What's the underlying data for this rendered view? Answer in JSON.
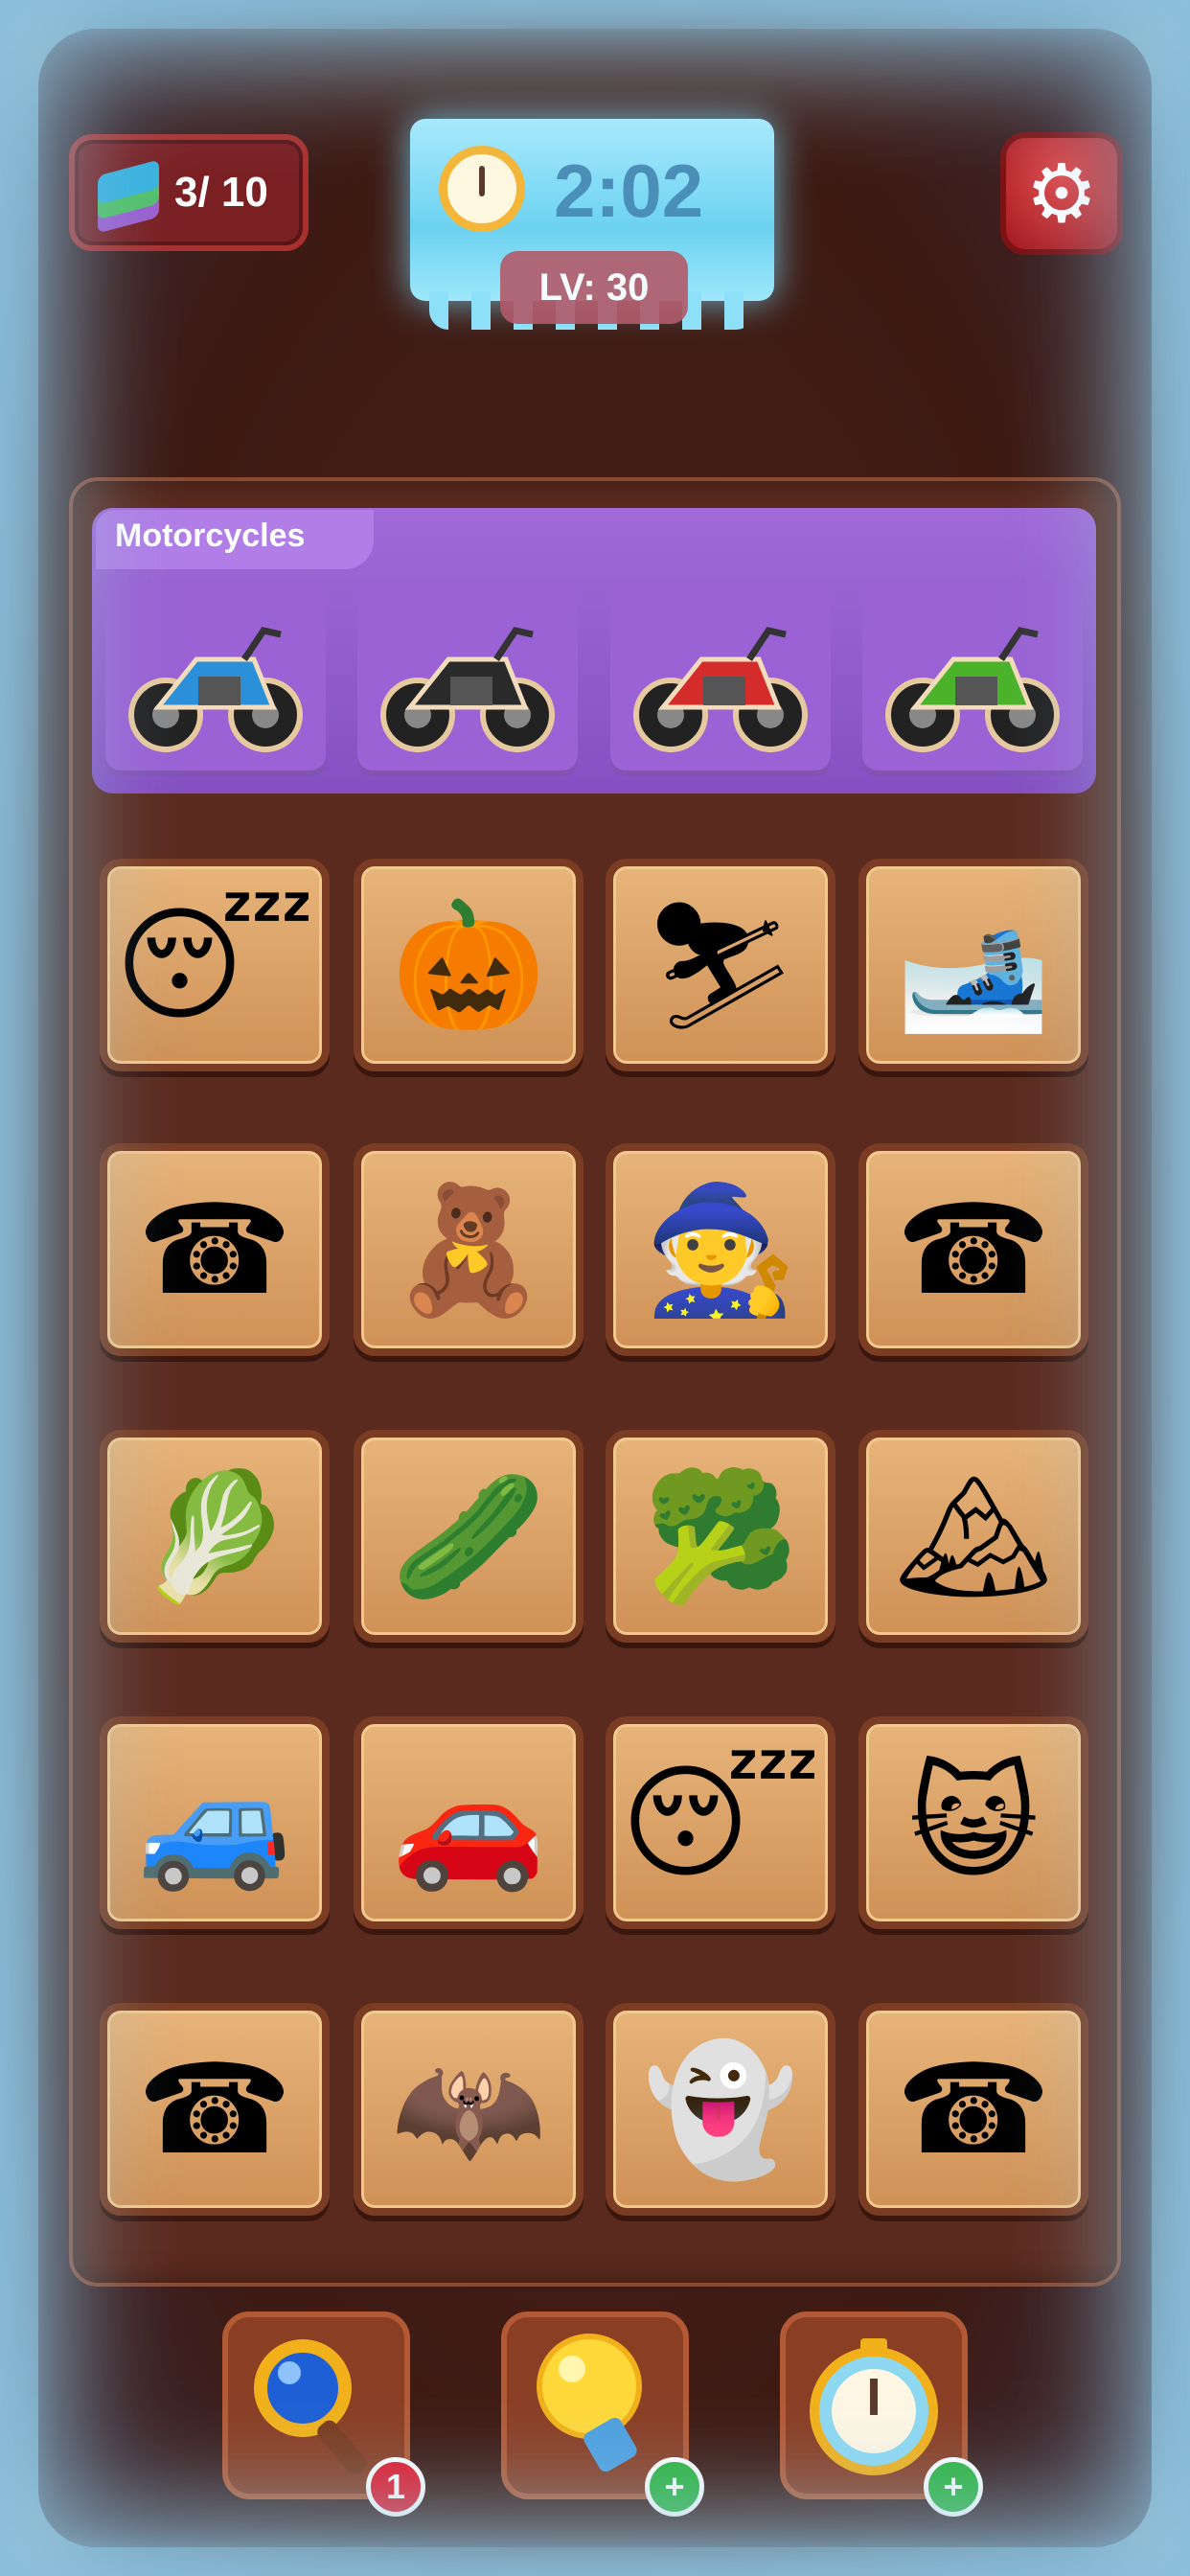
{
  "hud": {
    "levels_progress": "3/ 10",
    "timer": "2:02",
    "level_label": "LV: 30"
  },
  "category": {
    "title": "Motorcycles",
    "items": [
      {
        "name": "blue-sport-motorcycle-icon",
        "color": "#2c8fd9"
      },
      {
        "name": "black-cruiser-motorcycle-icon",
        "color": "#2a2a2a"
      },
      {
        "name": "red-touring-motorcycle-icon",
        "color": "#d42b2b"
      },
      {
        "name": "green-dirt-bike-icon",
        "color": "#4bb32a"
      }
    ]
  },
  "tiles": [
    {
      "name": "sleeping-girl-icon",
      "glyph": "😴"
    },
    {
      "name": "jack-o-lantern-icon",
      "glyph": "🎃"
    },
    {
      "name": "skier-pink-icon",
      "glyph": "⛷"
    },
    {
      "name": "skier-blue-icon",
      "glyph": "🎿"
    },
    {
      "name": "rotary-phone-gold-icon",
      "glyph": "☎"
    },
    {
      "name": "boy-with-teddy-icon",
      "glyph": "🧸"
    },
    {
      "name": "witch-icon",
      "glyph": "🧙"
    },
    {
      "name": "rotary-phone-brown-icon",
      "glyph": "☎"
    },
    {
      "name": "cabbage-icon",
      "glyph": "🥬"
    },
    {
      "name": "cucumber-icon",
      "glyph": "🥒"
    },
    {
      "name": "broccoli-icon",
      "glyph": "🥦"
    },
    {
      "name": "ski-girl-portrait-icon",
      "glyph": "🏔"
    },
    {
      "name": "blue-suv-icon",
      "glyph": "🚙"
    },
    {
      "name": "white-suv-icon",
      "glyph": "🚗"
    },
    {
      "name": "sleeping-boy-icon",
      "glyph": "😴"
    },
    {
      "name": "happy-cat-icon",
      "glyph": "😺"
    },
    {
      "name": "white-desk-phone-icon",
      "glyph": "☎"
    },
    {
      "name": "bat-icon",
      "glyph": "🦇"
    },
    {
      "name": "ghost-icon",
      "glyph": "👻"
    },
    {
      "name": "office-phone-icon",
      "glyph": "☎"
    }
  ],
  "tools": [
    {
      "name": "magnifier-tool",
      "badge": "1"
    },
    {
      "name": "hint-bulb-tool",
      "badge": "+"
    },
    {
      "name": "freeze-timer-tool",
      "badge": "+"
    }
  ]
}
